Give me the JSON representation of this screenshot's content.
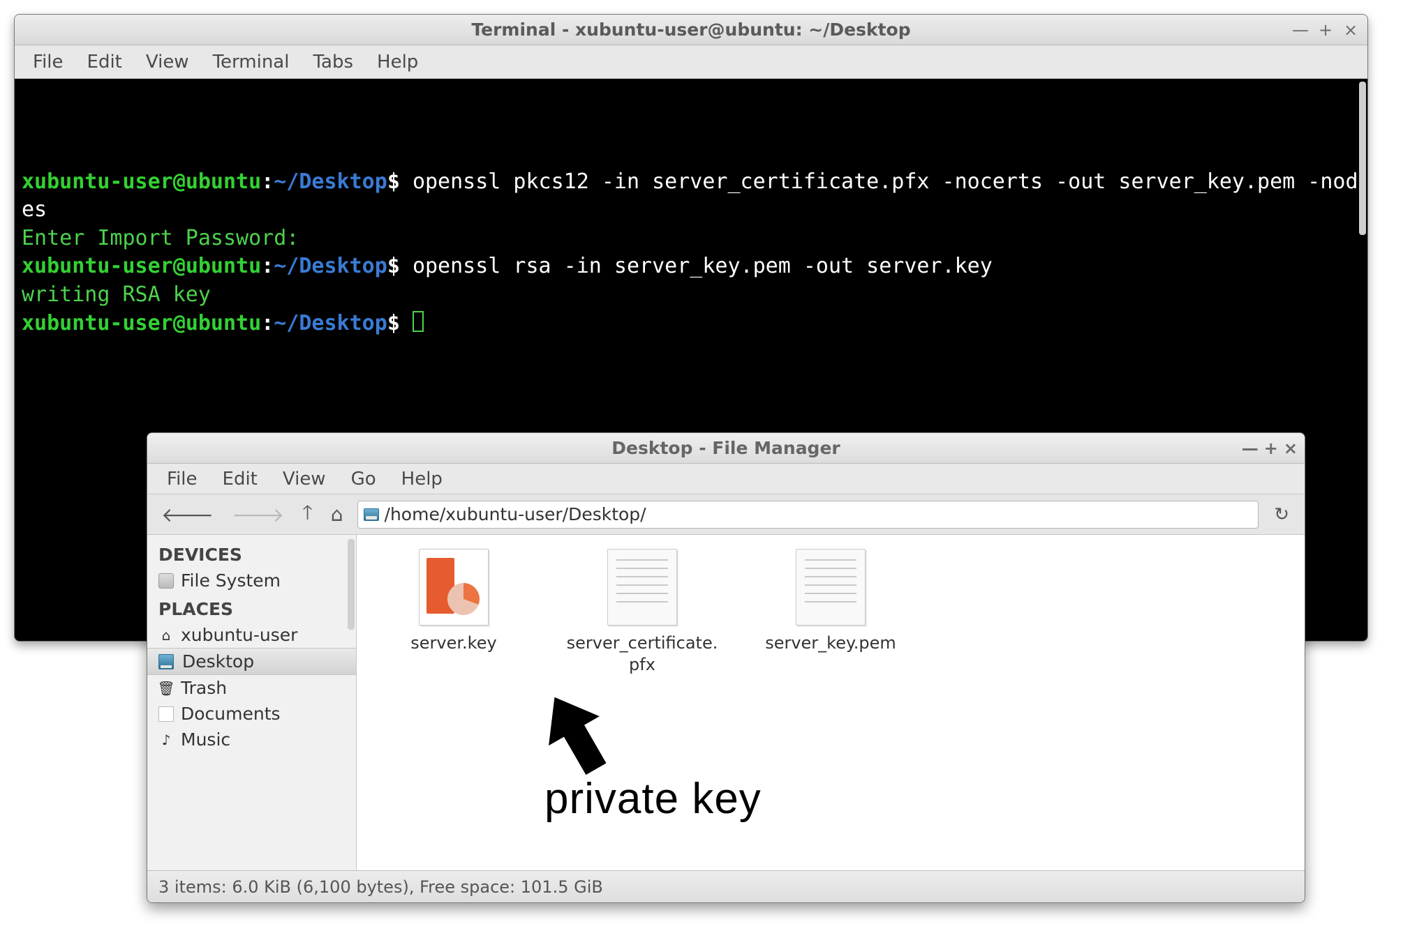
{
  "terminal": {
    "title": "Terminal - xubuntu-user@ubuntu: ~/Desktop",
    "controls": {
      "minimize": "—",
      "maximize": "+",
      "close": "×"
    },
    "menu": [
      "File",
      "Edit",
      "View",
      "Terminal",
      "Tabs",
      "Help"
    ],
    "prompt": {
      "user": "xubuntu-user",
      "host": "ubuntu",
      "path": "Desktop"
    },
    "lines": [
      {
        "type": "cmd",
        "text": "openssl pkcs12 -in server_certificate.pfx -nocerts -out server_key.pem -nodes"
      },
      {
        "type": "out",
        "text": "Enter Import Password:"
      },
      {
        "type": "cmd",
        "text": "openssl rsa -in server_key.pem -out server.key"
      },
      {
        "type": "out",
        "text": "writing RSA key"
      },
      {
        "type": "cmd",
        "text": ""
      }
    ]
  },
  "filemanager": {
    "title": "Desktop - File Manager",
    "controls": {
      "minimize": "—",
      "maximize": "+",
      "close": "×"
    },
    "menu": [
      "File",
      "Edit",
      "View",
      "Go",
      "Help"
    ],
    "location": "/home/xubuntu-user/Desktop/",
    "sidebar": {
      "sections": [
        {
          "head": "DEVICES",
          "items": [
            {
              "name": "File System",
              "icon": "disk"
            }
          ]
        },
        {
          "head": "PLACES",
          "items": [
            {
              "name": "xubuntu-user",
              "icon": "home"
            },
            {
              "name": "Desktop",
              "icon": "desktop",
              "selected": true
            },
            {
              "name": "Trash",
              "icon": "trash"
            },
            {
              "name": "Documents",
              "icon": "doc"
            },
            {
              "name": "Music",
              "icon": "music"
            }
          ]
        }
      ]
    },
    "files": [
      {
        "label": "server.key",
        "kind": "present"
      },
      {
        "label": "server_certificate.pfx",
        "kind": "text"
      },
      {
        "label": "server_key.pem",
        "kind": "text"
      }
    ],
    "status": "3 items: 6.0 KiB (6,100 bytes), Free space: 101.5 GiB"
  },
  "annotation": {
    "label": "private key"
  }
}
